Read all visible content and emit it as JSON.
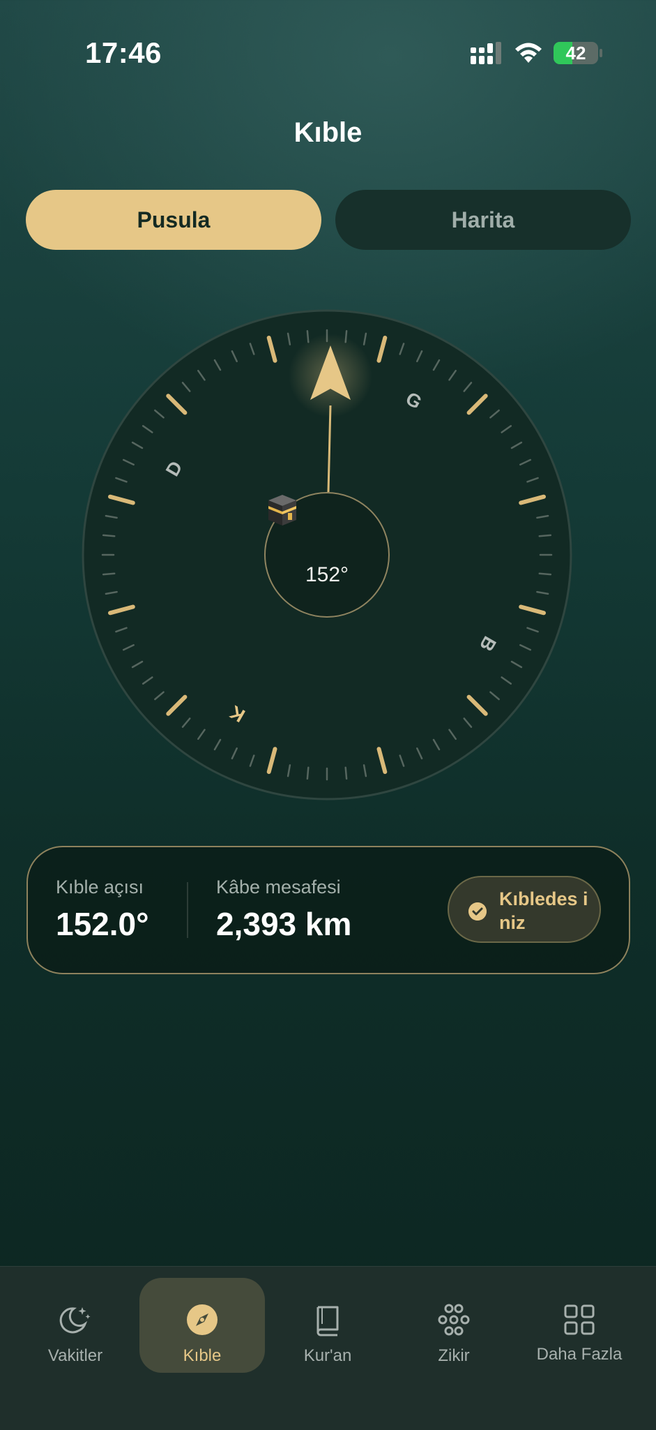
{
  "status_bar": {
    "time": "17:46",
    "battery_percent": 42,
    "battery_label": "42",
    "battery_color": "#30c75a"
  },
  "header": {
    "title": "Kıble"
  },
  "segments": [
    {
      "label": "Pusula",
      "active": true
    },
    {
      "label": "Harita",
      "active": false
    }
  ],
  "compass": {
    "qibla_bearing_label": "152°",
    "directions": {
      "north": "K",
      "east": "D",
      "south": "G",
      "west": "B"
    },
    "icons": {
      "arrow": "qibla-arrow-icon",
      "center": "kaaba-icon"
    }
  },
  "info": {
    "angle_label": "Kıble açısı",
    "angle_value": "152.0°",
    "distance_label": "Kâbe mesafesi",
    "distance_value": "2,393 km",
    "status_badge": "Kıbledes iniz",
    "status_icon": "check-icon"
  },
  "tab_bar": {
    "items": [
      {
        "label": "Vakitler",
        "icon": "moon-stars-icon",
        "active": false
      },
      {
        "label": "Kıble",
        "icon": "compass-icon",
        "active": true
      },
      {
        "label": "Kur'an",
        "icon": "book-icon",
        "active": false
      },
      {
        "label": "Zikir",
        "icon": "tasbih-icon",
        "active": false
      },
      {
        "label": "Daha Fazla",
        "icon": "grid-icon",
        "active": false
      }
    ]
  },
  "colors": {
    "accent_gold": "#e6c787",
    "background_dark": "#0f2e29",
    "card_border": "#8e825d"
  }
}
